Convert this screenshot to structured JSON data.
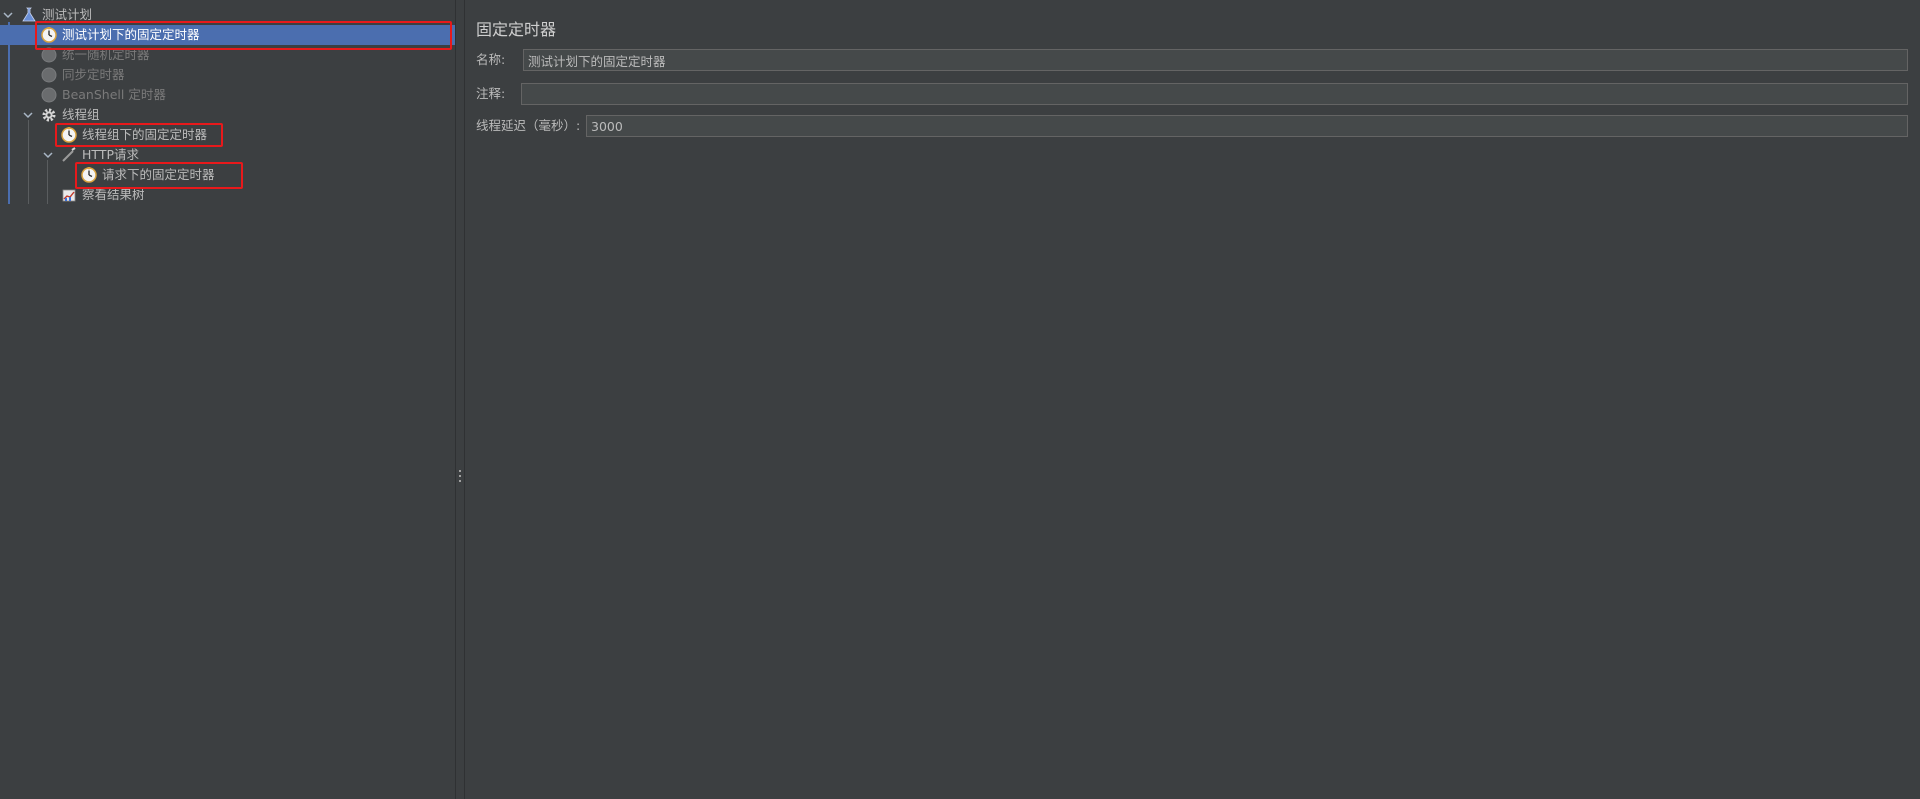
{
  "tree": {
    "root": {
      "label": "测试计划",
      "icon": "test-plan-icon"
    },
    "items": [
      {
        "label": "测试计划下的固定定时器",
        "icon": "timer-icon",
        "selected": true,
        "disabled": false
      },
      {
        "label": "统一随机定时器",
        "icon": "timer-icon",
        "selected": false,
        "disabled": true
      },
      {
        "label": "同步定时器",
        "icon": "timer-icon",
        "selected": false,
        "disabled": true
      },
      {
        "label": "BeanShell 定时器",
        "icon": "timer-icon",
        "selected": false,
        "disabled": true
      },
      {
        "label": "线程组",
        "icon": "gear-icon",
        "selected": false,
        "disabled": false
      },
      {
        "label": "线程组下的固定定时器",
        "icon": "timer-icon",
        "selected": false,
        "disabled": false
      },
      {
        "label": "HTTP请求",
        "icon": "pipette-icon",
        "selected": false,
        "disabled": false
      },
      {
        "label": "请求下的固定定时器",
        "icon": "timer-icon",
        "selected": false,
        "disabled": false
      },
      {
        "label": "察看结果树",
        "icon": "chart-icon",
        "selected": false,
        "disabled": false
      }
    ]
  },
  "editor": {
    "title": "固定定时器",
    "name_label": "名称:",
    "name_value": "测试计划下的固定定时器",
    "comment_label": "注释:",
    "comment_value": "",
    "delay_label": "线程延迟（毫秒）:",
    "delay_value": "3000"
  },
  "colors": {
    "background": "#3c3f41",
    "selection": "#4b6eaf",
    "highlight_border": "#e8191b",
    "input_background": "#45494a"
  }
}
